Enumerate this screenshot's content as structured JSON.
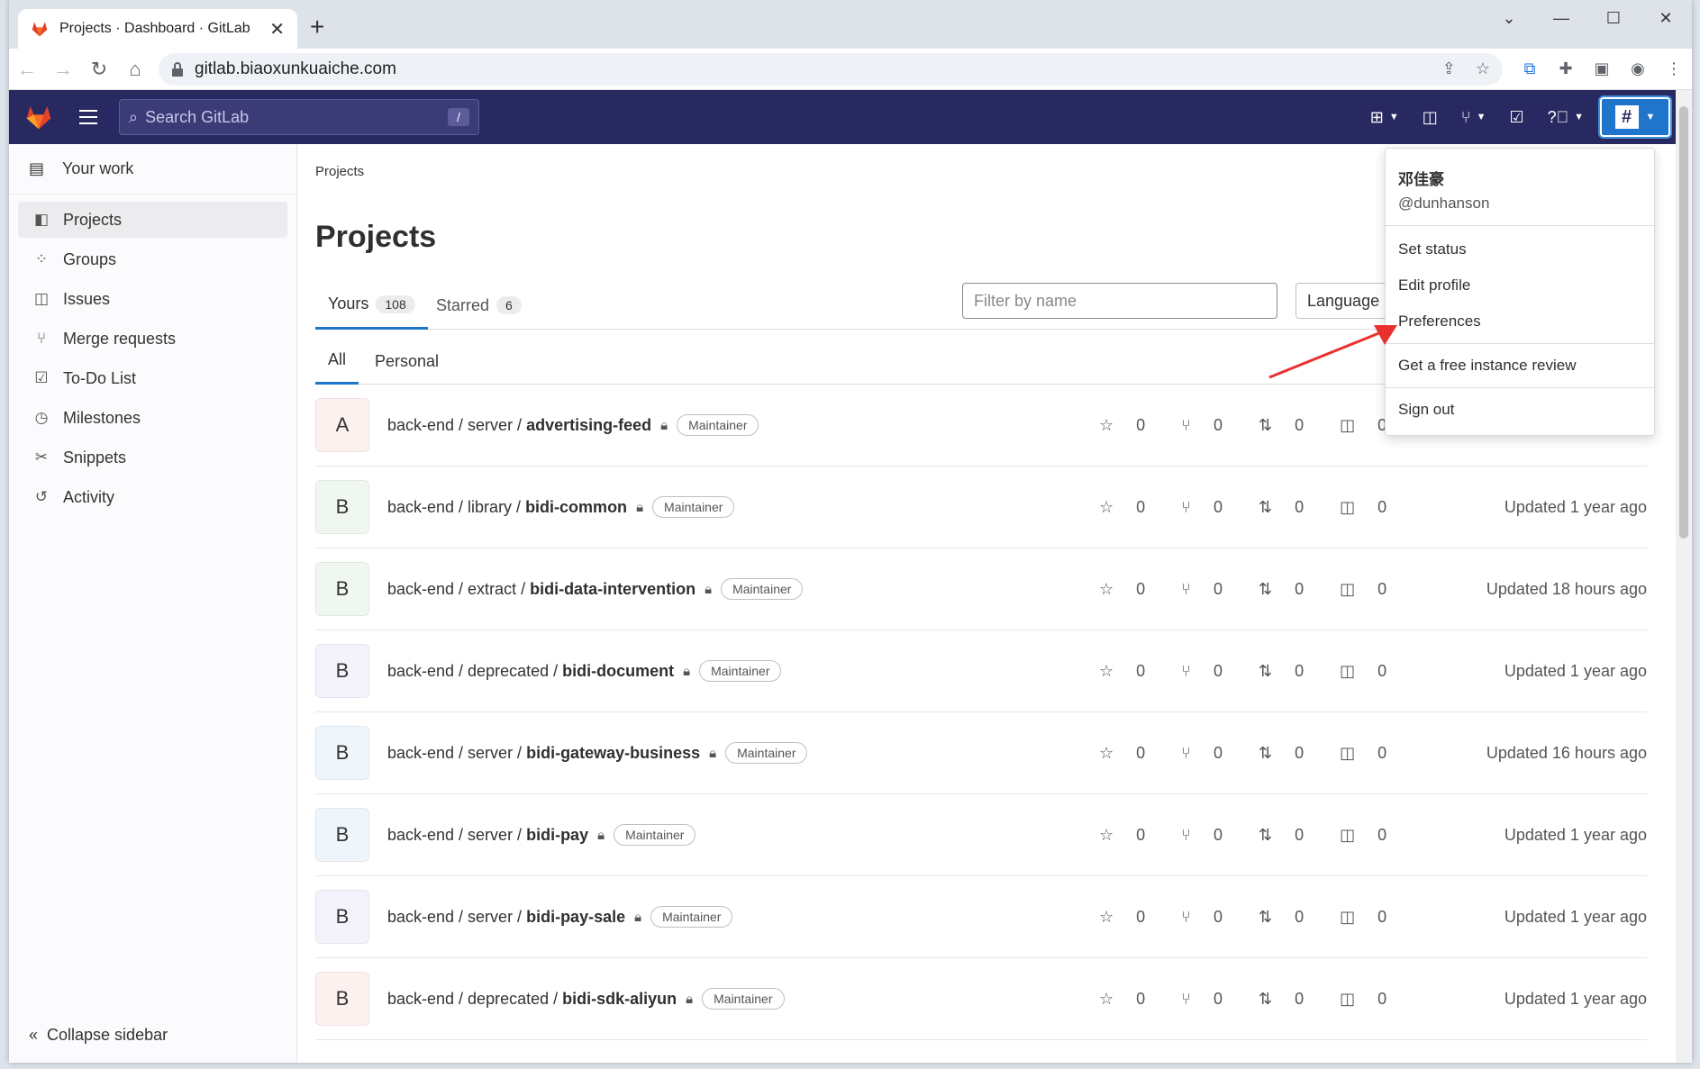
{
  "browser": {
    "tab_title": "Projects · Dashboard · GitLab",
    "url": "gitlab.biaoxunkuaiche.com"
  },
  "header": {
    "search_placeholder": "Search GitLab",
    "search_shortcut": "/"
  },
  "sidebar": {
    "top_label": "Your work",
    "items": [
      {
        "label": "Projects",
        "icon": "project-icon"
      },
      {
        "label": "Groups",
        "icon": "group-icon"
      },
      {
        "label": "Issues",
        "icon": "issues-icon"
      },
      {
        "label": "Merge requests",
        "icon": "merge-request-icon"
      },
      {
        "label": "To-Do List",
        "icon": "todo-icon"
      },
      {
        "label": "Milestones",
        "icon": "milestone-icon"
      },
      {
        "label": "Snippets",
        "icon": "snippet-icon"
      },
      {
        "label": "Activity",
        "icon": "history-icon"
      }
    ],
    "collapse_label": "Collapse sidebar"
  },
  "main": {
    "breadcrumb": "Projects",
    "title": "Projects",
    "tabs": [
      {
        "label": "Yours",
        "count": "108"
      },
      {
        "label": "Starred",
        "count": "6"
      }
    ],
    "filter_placeholder": "Filter by name",
    "language_label": "Language",
    "subtabs": [
      {
        "label": "All"
      },
      {
        "label": "Personal"
      }
    ]
  },
  "projects": [
    {
      "avatar": "A",
      "color": "#fcf1ef",
      "ns": "back-end / server / ",
      "name": "advertising-feed",
      "role": "Maintainer",
      "stars": "0",
      "forks": "0",
      "mrs": "0",
      "issues": "0",
      "updated": ""
    },
    {
      "avatar": "B",
      "color": "#f0f7f1",
      "ns": "back-end / library / ",
      "name": "bidi-common",
      "role": "Maintainer",
      "stars": "0",
      "forks": "0",
      "mrs": "0",
      "issues": "0",
      "updated": "Updated 1 year ago"
    },
    {
      "avatar": "B",
      "color": "#f0f7f1",
      "ns": "back-end / extract / ",
      "name": "bidi-data-intervention",
      "role": "Maintainer",
      "stars": "0",
      "forks": "0",
      "mrs": "0",
      "issues": "0",
      "updated": "Updated 18 hours ago"
    },
    {
      "avatar": "B",
      "color": "#f4f3fc",
      "ns": "back-end / deprecated / ",
      "name": "bidi-document",
      "role": "Maintainer",
      "stars": "0",
      "forks": "0",
      "mrs": "0",
      "issues": "0",
      "updated": "Updated 1 year ago"
    },
    {
      "avatar": "B",
      "color": "#eef5fb",
      "ns": "back-end / server / ",
      "name": "bidi-gateway-business",
      "role": "Maintainer",
      "stars": "0",
      "forks": "0",
      "mrs": "0",
      "issues": "0",
      "updated": "Updated 16 hours ago"
    },
    {
      "avatar": "B",
      "color": "#eef5fb",
      "ns": "back-end / server / ",
      "name": "bidi-pay",
      "role": "Maintainer",
      "stars": "0",
      "forks": "0",
      "mrs": "0",
      "issues": "0",
      "updated": "Updated 1 year ago"
    },
    {
      "avatar": "B",
      "color": "#f4f3fc",
      "ns": "back-end / server / ",
      "name": "bidi-pay-sale",
      "role": "Maintainer",
      "stars": "0",
      "forks": "0",
      "mrs": "0",
      "issues": "0",
      "updated": "Updated 1 year ago"
    },
    {
      "avatar": "B",
      "color": "#fcf1ef",
      "ns": "back-end / deprecated / ",
      "name": "bidi-sdk-aliyun",
      "role": "Maintainer",
      "stars": "0",
      "forks": "0",
      "mrs": "0",
      "issues": "0",
      "updated": "Updated 1 year ago"
    }
  ],
  "user_menu": {
    "name": "邓佳豪",
    "username": "@dunhanson",
    "items": [
      "Set status",
      "Edit profile",
      "Preferences",
      "Get a free instance review",
      "Sign out"
    ]
  },
  "colors": {
    "header_bg": "#292961",
    "accent": "#1f75cb",
    "annotation_arrow": "#e8312f"
  }
}
